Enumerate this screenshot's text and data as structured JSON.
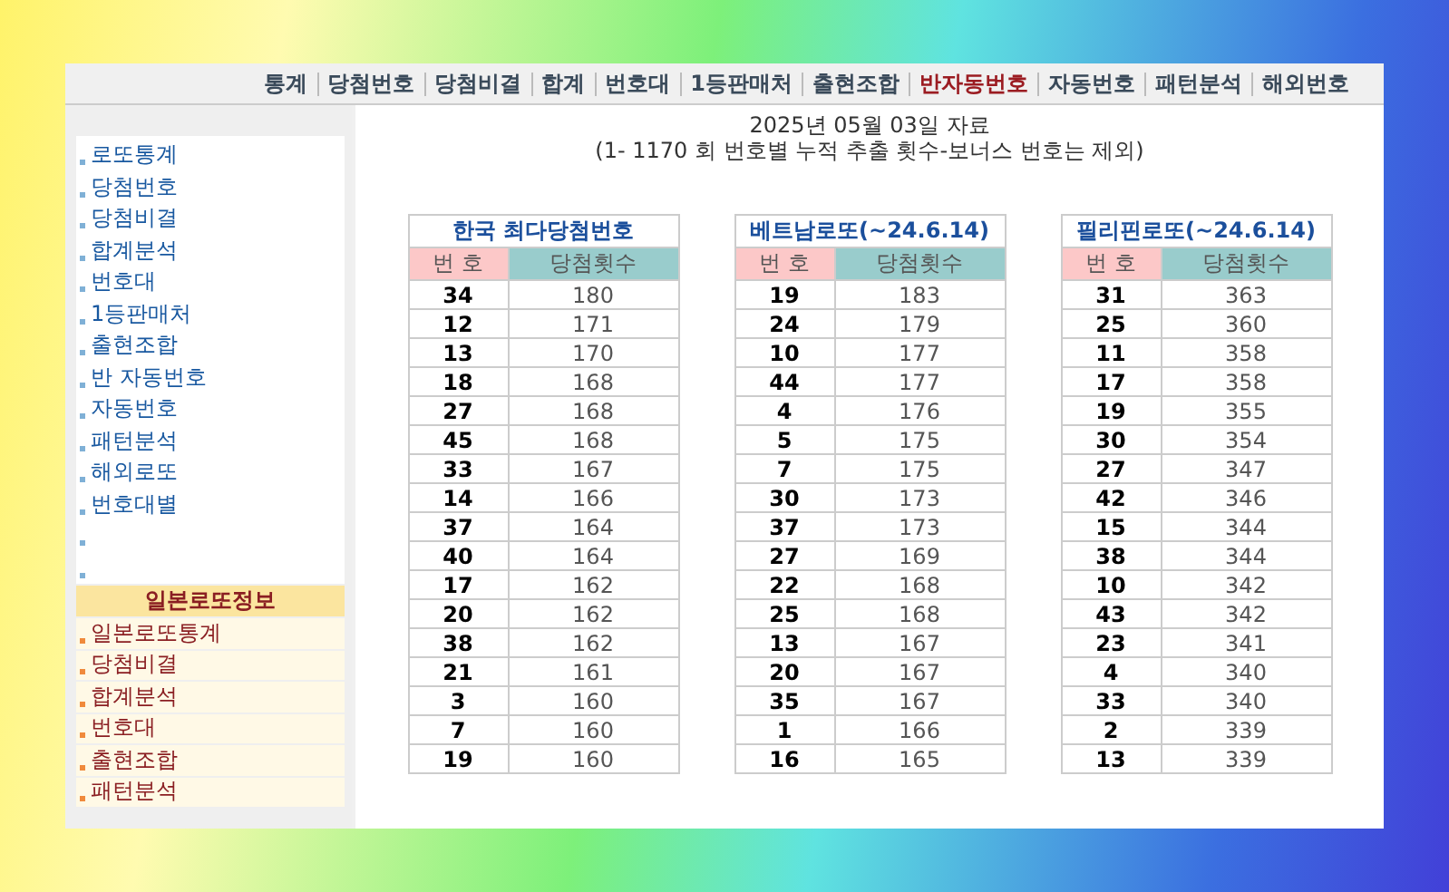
{
  "nav": [
    {
      "label": "통계",
      "selected": false
    },
    {
      "label": "당첨번호",
      "selected": false
    },
    {
      "label": "당첨비결",
      "selected": false
    },
    {
      "label": "합계",
      "selected": false
    },
    {
      "label": "번호대",
      "selected": false
    },
    {
      "label": "1등판매처",
      "selected": false
    },
    {
      "label": "출현조합",
      "selected": false
    },
    {
      "label": "반자동번호",
      "selected": true
    },
    {
      "label": "자동번호",
      "selected": false
    },
    {
      "label": "패턴분석",
      "selected": false
    },
    {
      "label": "해외번호",
      "selected": false
    }
  ],
  "header": {
    "date": "2025년 05월 03일 자료",
    "note": "(1- 1170 회 번호별 누적 추출 횟수-보너스 번호는 제외)"
  },
  "sidebar": {
    "items": [
      {
        "kind": "link",
        "label": "로또통계"
      },
      {
        "kind": "link",
        "label": "당첨번호"
      },
      {
        "kind": "link",
        "label": "당첨비결"
      },
      {
        "kind": "link",
        "label": "합계분석"
      },
      {
        "kind": "link",
        "label": "번호대"
      },
      {
        "kind": "link",
        "label": "1등판매처"
      },
      {
        "kind": "link",
        "label": "출현조합"
      },
      {
        "kind": "link",
        "label": "반 자동번호"
      },
      {
        "kind": "link",
        "label": "자동번호"
      },
      {
        "kind": "link",
        "label": "패턴분석"
      },
      {
        "kind": "link",
        "label": "해외로또"
      },
      {
        "kind": "link",
        "label": "번호대별"
      },
      {
        "kind": "bullet"
      },
      {
        "kind": "bullet"
      }
    ],
    "japan": {
      "title": "일본로또정보",
      "items": [
        "일본로또통계",
        "당첨비결",
        "합계분석",
        "번호대",
        "출현조합",
        "패턴분석"
      ]
    }
  },
  "tables": [
    {
      "title": "한국 최다당첨번호",
      "columns": [
        "번 호",
        "당첨횟수"
      ],
      "rows": [
        [
          "34",
          "180"
        ],
        [
          "12",
          "171"
        ],
        [
          "13",
          "170"
        ],
        [
          "18",
          "168"
        ],
        [
          "27",
          "168"
        ],
        [
          "45",
          "168"
        ],
        [
          "33",
          "167"
        ],
        [
          "14",
          "166"
        ],
        [
          "37",
          "164"
        ],
        [
          "40",
          "164"
        ],
        [
          "17",
          "162"
        ],
        [
          "20",
          "162"
        ],
        [
          "38",
          "162"
        ],
        [
          "21",
          "161"
        ],
        [
          "3",
          "160"
        ],
        [
          "7",
          "160"
        ],
        [
          "19",
          "160"
        ]
      ]
    },
    {
      "title": "베트남로또(~24.6.14)",
      "columns": [
        "번 호",
        "당첨횟수"
      ],
      "rows": [
        [
          "19",
          "183"
        ],
        [
          "24",
          "179"
        ],
        [
          "10",
          "177"
        ],
        [
          "44",
          "177"
        ],
        [
          "4",
          "176"
        ],
        [
          "5",
          "175"
        ],
        [
          "7",
          "175"
        ],
        [
          "30",
          "173"
        ],
        [
          "37",
          "173"
        ],
        [
          "27",
          "169"
        ],
        [
          "22",
          "168"
        ],
        [
          "25",
          "168"
        ],
        [
          "13",
          "167"
        ],
        [
          "20",
          "167"
        ],
        [
          "35",
          "167"
        ],
        [
          "1",
          "166"
        ],
        [
          "16",
          "165"
        ]
      ]
    },
    {
      "title": "필리핀로또(~24.6.14)",
      "columns": [
        "번 호",
        "당첨횟수"
      ],
      "rows": [
        [
          "31",
          "363"
        ],
        [
          "25",
          "360"
        ],
        [
          "11",
          "358"
        ],
        [
          "17",
          "358"
        ],
        [
          "19",
          "355"
        ],
        [
          "30",
          "354"
        ],
        [
          "27",
          "347"
        ],
        [
          "42",
          "346"
        ],
        [
          "15",
          "344"
        ],
        [
          "38",
          "344"
        ],
        [
          "10",
          "342"
        ],
        [
          "43",
          "342"
        ],
        [
          "23",
          "341"
        ],
        [
          "4",
          "340"
        ],
        [
          "33",
          "340"
        ],
        [
          "2",
          "339"
        ],
        [
          "13",
          "339"
        ]
      ]
    }
  ]
}
